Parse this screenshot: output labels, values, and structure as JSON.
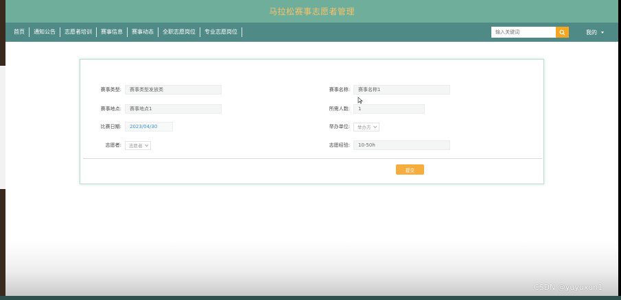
{
  "header": {
    "title": "马拉松赛事志愿者管理"
  },
  "nav": {
    "items": [
      {
        "label": "首页"
      },
      {
        "label": "通知公告"
      },
      {
        "label": "志愿者培训"
      },
      {
        "label": "赛事信息"
      },
      {
        "label": "赛事动态"
      },
      {
        "label": "全职志愿岗位"
      },
      {
        "label": "专业志愿岗位"
      }
    ],
    "search_placeholder": "输入关键词",
    "user_label": "我的"
  },
  "form": {
    "left": [
      {
        "label": "赛事类型:",
        "value": "赛事类型发放类"
      },
      {
        "label": "赛事地点:",
        "value": "赛事地点1"
      },
      {
        "label": "比赛日期:",
        "value": "2023/04/30"
      },
      {
        "label": "志愿者:",
        "value": "志愿者"
      }
    ],
    "right": [
      {
        "label": "赛事名称:",
        "value": "赛事名称1"
      },
      {
        "label": "所需人数:",
        "value": "1"
      },
      {
        "label": "举办单位:",
        "value": "举办方"
      },
      {
        "label": "志愿经验:",
        "value": "10-50h"
      }
    ],
    "submit_label": "提交"
  },
  "watermark": "CSDN @yuyuxun1",
  "colors": {
    "header": "#6fae9a",
    "nav": "#4f8a86",
    "title": "#f5c26b",
    "accent": "#f5a623"
  }
}
